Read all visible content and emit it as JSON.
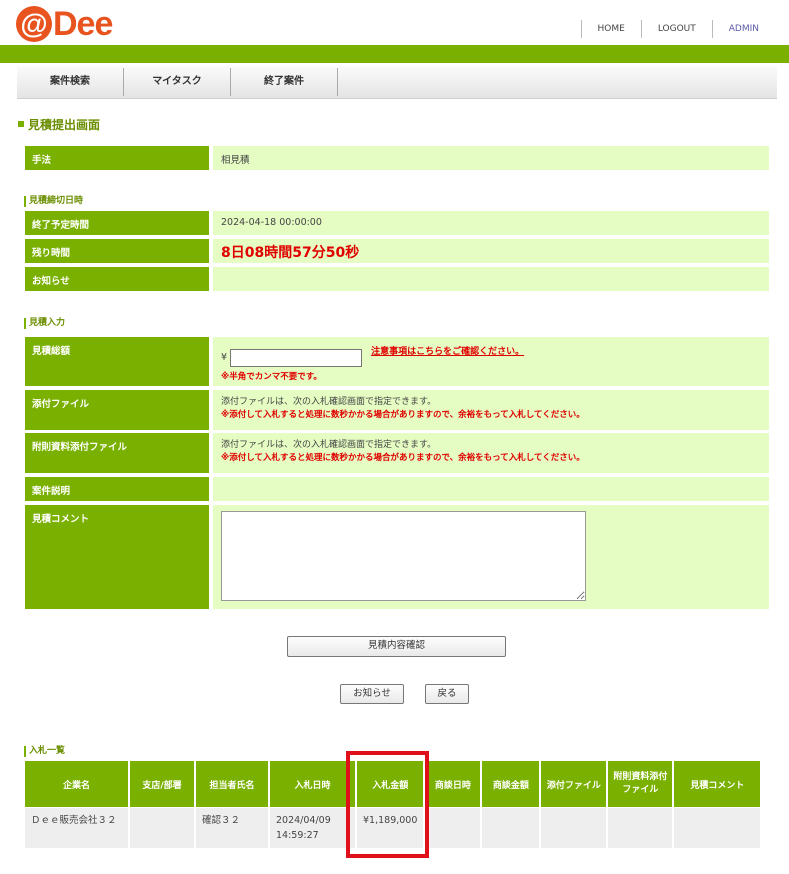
{
  "header": {
    "logo_at": "@",
    "logo_text": "Dee",
    "nav": [
      "HOME",
      "LOGOUT",
      "ADMIN"
    ]
  },
  "menu": [
    "案件検索",
    "マイタスク",
    "終了案件"
  ],
  "page_title": "見積提出画面",
  "method": {
    "label": "手法",
    "value": "相見積"
  },
  "deadline_section": {
    "title": "見積締切日時",
    "end_label": "終了予定時間",
    "end_value": "2024-04-18 00:00:00",
    "remain_label": "残り時間",
    "remain_value": "8日08時間57分50秒",
    "notice_label": "お知らせ",
    "notice_value": ""
  },
  "input_section": {
    "title": "見積入力",
    "total_label": "見積総額",
    "currency": "¥",
    "amount_value": "",
    "notes_link": "注意事項はこちらをご確認ください。",
    "comma_note": "※半角でカンマ不要です。",
    "attach_label": "添付ファイル",
    "attach_info": "添付ファイルは、次の入札確認画面で指定できます。",
    "attach_warn": "※添付して入札すると処理に数秒かかる場合がありますので、余裕をもって入札してください。",
    "ref_attach_label": "附則資料添付ファイル",
    "ref_attach_info": "添付ファイルは、次の入札確認画面で指定できます。",
    "ref_attach_warn": "※添付して入札すると処理に数秒かかる場合がありますので、余裕をもって入札してください。",
    "desc_label": "案件説明",
    "desc_value": "",
    "comment_label": "見積コメント",
    "comment_value": ""
  },
  "buttons": {
    "confirm": "見積内容確認",
    "notice": "お知らせ",
    "back": "戻る"
  },
  "bids": {
    "title": "入札一覧",
    "columns": [
      "企業名",
      "支店/部署",
      "担当者氏名",
      "入札日時",
      "入札金額",
      "商談日時",
      "商談金額",
      "添付ファイル",
      "附則資料添付\nファイル",
      "見積コメント"
    ],
    "rows": [
      [
        "Ｄｅｅ販売会社３２",
        "",
        "確認３２",
        "2024/04/09\n14:59:27",
        "¥1,189,000",
        "",
        "",
        "",
        "",
        ""
      ]
    ]
  },
  "colors": {
    "accent": "#7ab000",
    "label_bg": "#7ab000",
    "value_bg": "#e5fcc3",
    "alert": "#e00000",
    "logo": "#e8531e",
    "highlight": "#e0101a"
  }
}
